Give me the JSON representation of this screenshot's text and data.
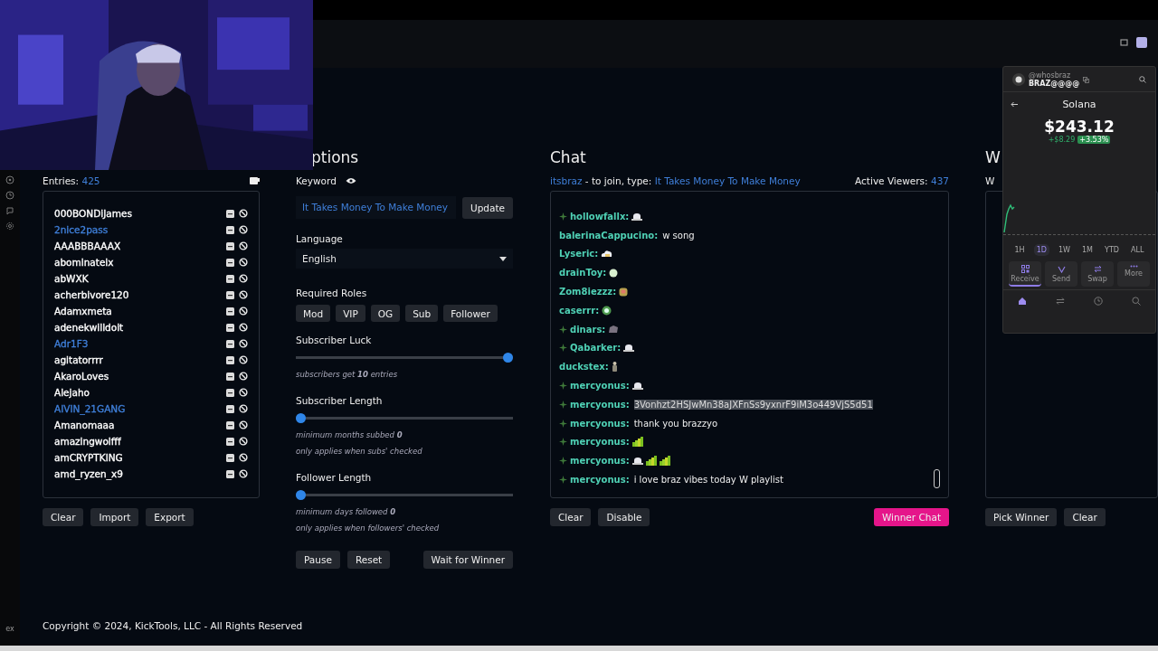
{
  "sidebar_footer": "ex",
  "entries": {
    "label": "Entries:",
    "count": "425",
    "items": [
      {
        "name": "000BONDiJames",
        "color": "#ffffff"
      },
      {
        "name": "2nice2pass",
        "color": "#3f7fd9"
      },
      {
        "name": "AAABBBAAAX",
        "color": "#ffffff"
      },
      {
        "name": "abominateix",
        "color": "#ffffff"
      },
      {
        "name": "abWXK",
        "color": "#ffffff"
      },
      {
        "name": "acherbivore120",
        "color": "#ffffff"
      },
      {
        "name": "Adamxmeta",
        "color": "#ffffff"
      },
      {
        "name": "adenekwilldoit",
        "color": "#ffffff"
      },
      {
        "name": "Adr1F3",
        "color": "#3f7fd9"
      },
      {
        "name": "agitatorrrr",
        "color": "#ffffff"
      },
      {
        "name": "AkaroLoves",
        "color": "#ffffff"
      },
      {
        "name": "Alejaho",
        "color": "#ffffff"
      },
      {
        "name": "AIVIN_21GANG",
        "color": "#3f7fd9"
      },
      {
        "name": "Amanomaaa",
        "color": "#ffffff"
      },
      {
        "name": "amazingwolfff",
        "color": "#ffffff"
      },
      {
        "name": "amCRYPTKING",
        "color": "#ffffff"
      },
      {
        "name": "amd_ryzen_x9",
        "color": "#ffffff"
      }
    ],
    "buttons": [
      "Clear",
      "Import",
      "Export"
    ]
  },
  "options": {
    "title": "ptions",
    "keyword_label": "Keyword",
    "keyword_value": "It Takes Money To Make Money",
    "update_button": "Update",
    "language_label": "Language",
    "language_value": "English",
    "roles_label": "Required Roles",
    "roles": [
      "Mod",
      "VIP",
      "OG",
      "Sub",
      "Follower"
    ],
    "sliders": [
      {
        "label": "Subscriber Luck",
        "level": 1,
        "hints": [
          "subscribers get **10** entries"
        ]
      },
      {
        "label": "Subscriber Length",
        "level": 0,
        "hints": [
          "minimum months subbed **0**",
          "only applies when subs' checked"
        ]
      },
      {
        "label": "Follower Length",
        "level": 0,
        "hints": [
          "minimum days followed **0**",
          "only applies when followers' checked"
        ]
      }
    ],
    "buttons": [
      "Pause",
      "Reset"
    ],
    "wait_button": "Wait for Winner"
  },
  "chat": {
    "title": "Chat",
    "channel": "itsbraz",
    "join_text": "- to join, type:",
    "keyword": "It Takes Money To Make Money",
    "viewers_label": "Active Viewers:",
    "viewers": "437",
    "messages": [
      {
        "badge": true,
        "user": "hollowfallx:",
        "emotes": [
          {
            "kind": "hat"
          }
        ]
      },
      {
        "badge": false,
        "user": "balerinaCappucino:",
        "text": "w song",
        "highlighted": false
      },
      {
        "badge": false,
        "user": "Lyseric:",
        "emotes": [
          {
            "kind": "cloud"
          }
        ]
      },
      {
        "badge": false,
        "user": "drainToy:",
        "emotes": [
          {
            "kind": "dot"
          }
        ]
      },
      {
        "badge": false,
        "user": "Zom8iezzz:",
        "emotes": [
          {
            "kind": "face"
          }
        ]
      },
      {
        "badge": false,
        "user": "caserrr:",
        "emotes": [
          {
            "kind": "frog"
          }
        ]
      },
      {
        "badge": true,
        "user": "dinars:",
        "emotes": [
          {
            "kind": "beast"
          }
        ]
      },
      {
        "badge": true,
        "user": "Qabarker:",
        "emotes": [
          {
            "kind": "hat"
          }
        ]
      },
      {
        "badge": false,
        "user": "duckstex:",
        "emotes": [
          {
            "kind": "figure"
          }
        ]
      },
      {
        "badge": true,
        "user": "mercyonus:",
        "emotes": [
          {
            "kind": "hat"
          }
        ]
      },
      {
        "badge": true,
        "user": "mercyonus:",
        "text": "3Vonhzt2HSJwMn38aJXFnSs9yxnrF9iM3o449VjS5d51",
        "highlighted": true
      },
      {
        "badge": true,
        "user": "mercyonus:",
        "text": "thank you brazzyo",
        "highlighted": false
      },
      {
        "badge": true,
        "user": "mercyonus:",
        "emotes": [
          {
            "kind": "bars"
          }
        ]
      },
      {
        "badge": true,
        "user": "mercyonus:",
        "emotes": [
          {
            "kind": "hat"
          },
          {
            "kind": "bars"
          },
          {
            "kind": "bars"
          }
        ]
      },
      {
        "badge": true,
        "user": "mercyonus:",
        "text": "i love braz vibes today W playlist",
        "highlighted": false
      }
    ],
    "buttons": [
      "Clear",
      "Disable"
    ],
    "winner_button": "Winner Chat"
  },
  "winner": {
    "title": "W",
    "label": "W",
    "buttons": [
      "Pick Winner",
      "Clear"
    ]
  },
  "footer": "Copyright © 2024, KickTools, LLC - All Rights Reserved",
  "wallet": {
    "handle": "@whosbraz",
    "account": "BRAZ@@@@",
    "asset": "Solana",
    "price": "$243.12",
    "change": "+$8.29",
    "change_pct": "+3.53%",
    "ranges": [
      {
        "label": "1H",
        "selected": false
      },
      {
        "label": "1D",
        "selected": true
      },
      {
        "label": "1W",
        "selected": false
      },
      {
        "label": "1M",
        "selected": false
      },
      {
        "label": "YTD",
        "selected": false
      },
      {
        "label": "ALL",
        "selected": false
      }
    ],
    "actions": [
      {
        "kind": "receive",
        "label": "Receive",
        "selected": true
      },
      {
        "kind": "send",
        "label": "Send",
        "selected": false
      },
      {
        "kind": "swap",
        "label": "Swap",
        "selected": false
      },
      {
        "kind": "more",
        "label": "More",
        "selected": false
      }
    ],
    "nav": [
      {
        "kind": "home",
        "selected": true
      },
      {
        "kind": "swap",
        "selected": false
      },
      {
        "kind": "history",
        "selected": false
      },
      {
        "kind": "search",
        "selected": false
      }
    ]
  }
}
